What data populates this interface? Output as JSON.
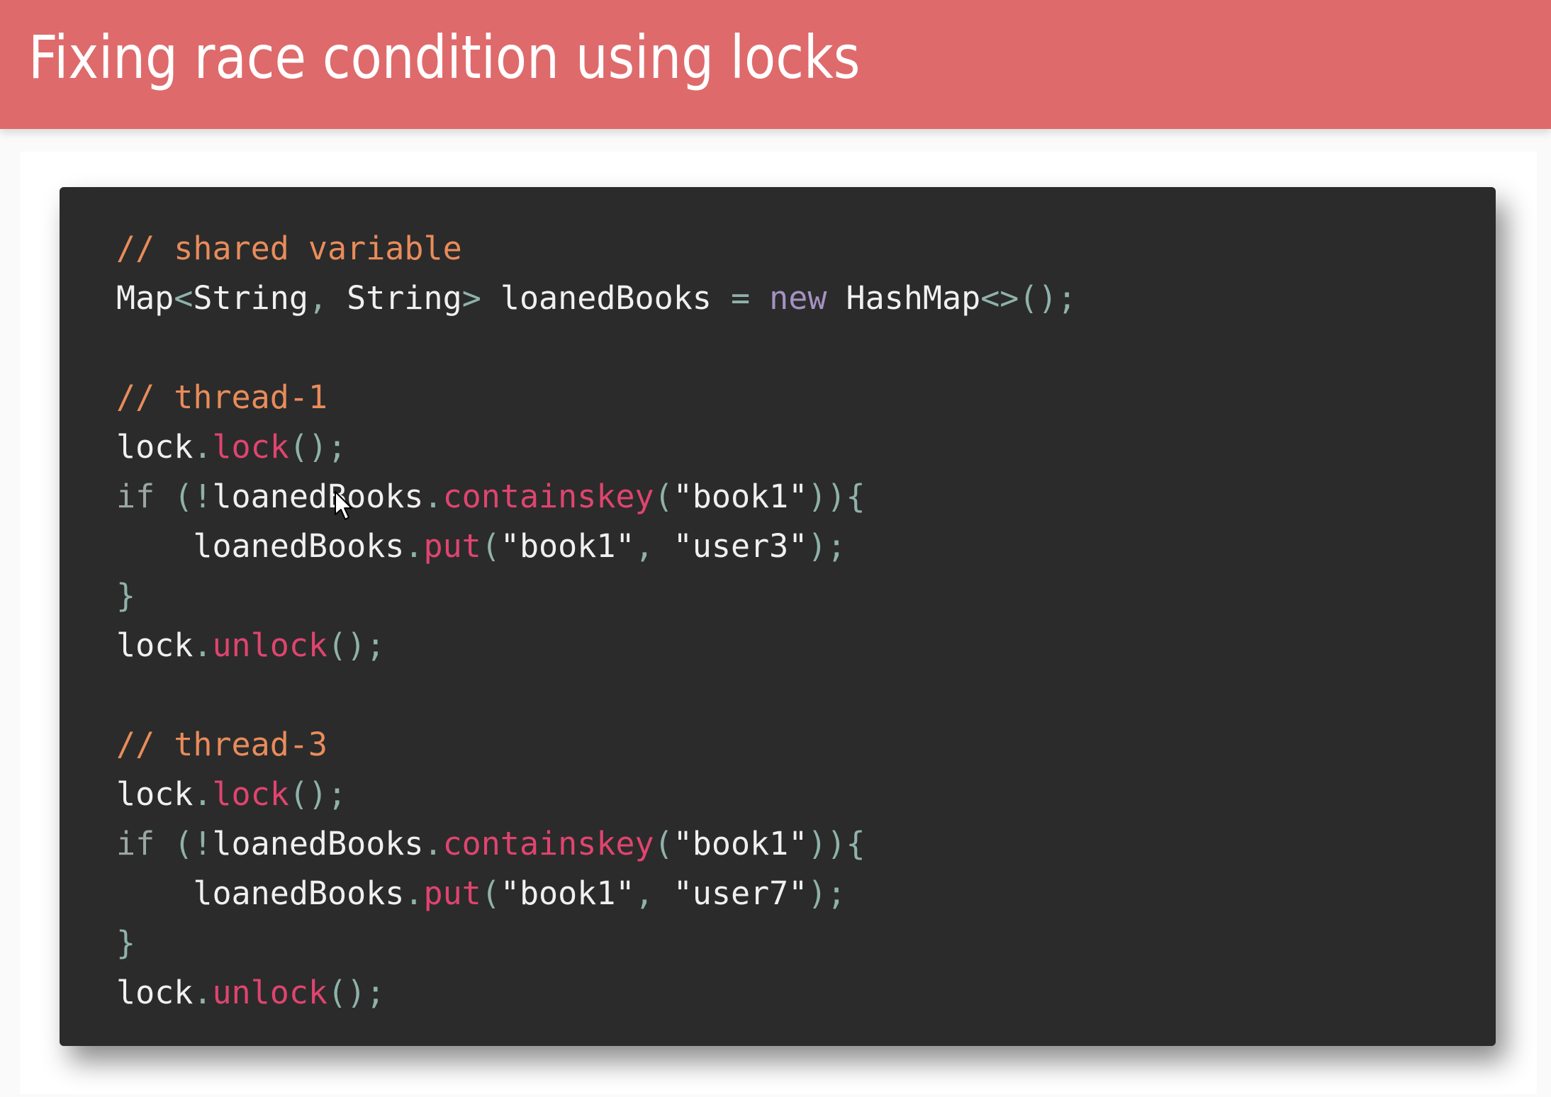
{
  "slide": {
    "title": "Fixing race condition using locks"
  },
  "code": {
    "lines": [
      {
        "tokens": [
          {
            "c": "comment",
            "t": "// shared variable"
          }
        ]
      },
      {
        "tokens": [
          {
            "c": "type",
            "t": "Map"
          },
          {
            "c": "punct",
            "t": "<"
          },
          {
            "c": "type",
            "t": "String"
          },
          {
            "c": "punct",
            "t": ", "
          },
          {
            "c": "type",
            "t": "String"
          },
          {
            "c": "punct",
            "t": ">"
          },
          {
            "c": "type",
            "t": " loanedBooks "
          },
          {
            "c": "punct",
            "t": "="
          },
          {
            "c": "type",
            "t": " "
          },
          {
            "c": "kw-new",
            "t": "new"
          },
          {
            "c": "type",
            "t": " HashMap"
          },
          {
            "c": "punct",
            "t": "<>();"
          }
        ]
      },
      {
        "tokens": []
      },
      {
        "tokens": [
          {
            "c": "comment",
            "t": "// thread-1"
          }
        ]
      },
      {
        "tokens": [
          {
            "c": "type",
            "t": "lock"
          },
          {
            "c": "punct",
            "t": "."
          },
          {
            "c": "method",
            "t": "lock"
          },
          {
            "c": "punct",
            "t": "();"
          }
        ]
      },
      {
        "tokens": [
          {
            "c": "kw",
            "t": "if"
          },
          {
            "c": "punct",
            "t": " (!"
          },
          {
            "c": "type",
            "t": "loanedBooks"
          },
          {
            "c": "punct",
            "t": "."
          },
          {
            "c": "method",
            "t": "containskey"
          },
          {
            "c": "punct",
            "t": "("
          },
          {
            "c": "type",
            "t": "\"book1\""
          },
          {
            "c": "punct",
            "t": ")){"
          }
        ]
      },
      {
        "tokens": [
          {
            "c": "type",
            "t": "    loanedBooks"
          },
          {
            "c": "punct",
            "t": "."
          },
          {
            "c": "method",
            "t": "put"
          },
          {
            "c": "punct",
            "t": "("
          },
          {
            "c": "type",
            "t": "\"book1\""
          },
          {
            "c": "punct",
            "t": ", "
          },
          {
            "c": "type",
            "t": "\"user3\""
          },
          {
            "c": "punct",
            "t": ");"
          }
        ]
      },
      {
        "tokens": [
          {
            "c": "punct",
            "t": "}"
          }
        ]
      },
      {
        "tokens": [
          {
            "c": "type",
            "t": "lock"
          },
          {
            "c": "punct",
            "t": "."
          },
          {
            "c": "method",
            "t": "unlock"
          },
          {
            "c": "punct",
            "t": "();"
          }
        ]
      },
      {
        "tokens": []
      },
      {
        "tokens": [
          {
            "c": "comment",
            "t": "// thread-3"
          }
        ]
      },
      {
        "tokens": [
          {
            "c": "type",
            "t": "lock"
          },
          {
            "c": "punct",
            "t": "."
          },
          {
            "c": "method",
            "t": "lock"
          },
          {
            "c": "punct",
            "t": "();"
          }
        ]
      },
      {
        "tokens": [
          {
            "c": "kw",
            "t": "if"
          },
          {
            "c": "punct",
            "t": " (!"
          },
          {
            "c": "type",
            "t": "loanedBooks"
          },
          {
            "c": "punct",
            "t": "."
          },
          {
            "c": "method",
            "t": "containskey"
          },
          {
            "c": "punct",
            "t": "("
          },
          {
            "c": "type",
            "t": "\"book1\""
          },
          {
            "c": "punct",
            "t": ")){"
          }
        ]
      },
      {
        "tokens": [
          {
            "c": "type",
            "t": "    loanedBooks"
          },
          {
            "c": "punct",
            "t": "."
          },
          {
            "c": "method",
            "t": "put"
          },
          {
            "c": "punct",
            "t": "("
          },
          {
            "c": "type",
            "t": "\"book1\""
          },
          {
            "c": "punct",
            "t": ", "
          },
          {
            "c": "type",
            "t": "\"user7\""
          },
          {
            "c": "punct",
            "t": ");"
          }
        ]
      },
      {
        "tokens": [
          {
            "c": "punct",
            "t": "}"
          }
        ]
      },
      {
        "tokens": [
          {
            "c": "type",
            "t": "lock"
          },
          {
            "c": "punct",
            "t": "."
          },
          {
            "c": "method",
            "t": "unlock"
          },
          {
            "c": "punct",
            "t": "();"
          }
        ]
      }
    ]
  },
  "colors": {
    "title_bar": "#df6a6b",
    "code_background": "#2b2b2b",
    "comment": "#e98c5a",
    "method": "#e0446f",
    "keyword_new": "#a591c2"
  },
  "icons": {
    "cursor": "mouse-pointer-icon"
  }
}
